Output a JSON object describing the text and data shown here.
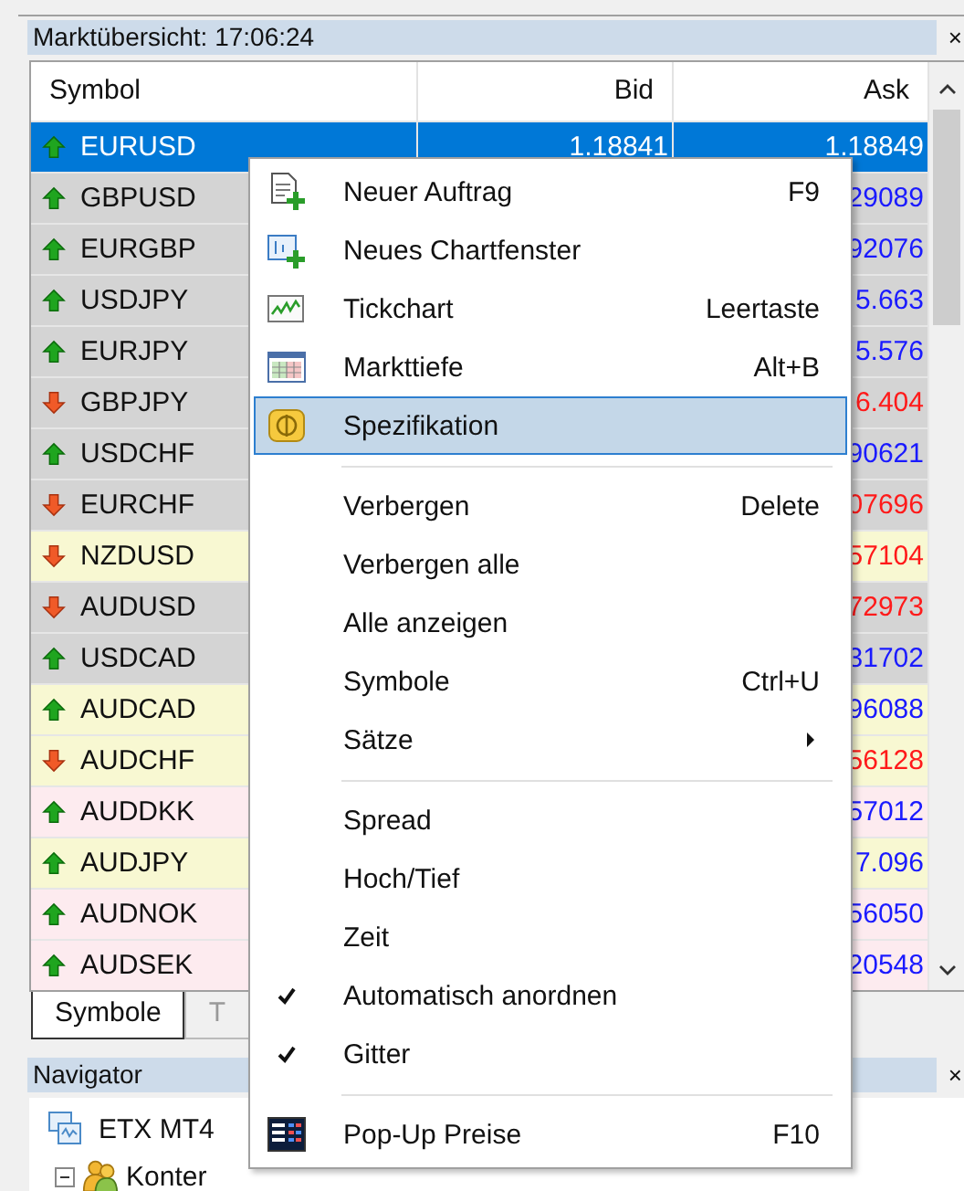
{
  "market_watch": {
    "title": "Marktübersicht: 17:06:24",
    "close": "×",
    "columns": [
      "Symbol",
      "Bid",
      "Ask"
    ],
    "rows": [
      {
        "symbol": "EURUSD",
        "bid": "1.18841",
        "ask": "1.18849",
        "kind": "up",
        "color": "#0078d7",
        "selected": true
      },
      {
        "symbol": "GBPUSD",
        "ask": "29089",
        "kind": "up",
        "color": "#d4d4d4",
        "selected": false
      },
      {
        "symbol": "EURGBP",
        "ask": "92076",
        "kind": "up",
        "color": "#d4d4d4",
        "selected": false
      },
      {
        "symbol": "USDJPY",
        "ask": "5.663",
        "kind": "up",
        "color": "#d4d4d4",
        "selected": false
      },
      {
        "symbol": "EURJPY",
        "ask": "5.576",
        "kind": "up",
        "color": "#d4d4d4",
        "selected": false
      },
      {
        "symbol": "GBPJPY",
        "ask": "6.404",
        "kind": "down",
        "color": "#d4d4d4",
        "selected": false
      },
      {
        "symbol": "USDCHF",
        "ask": "90621",
        "kind": "up",
        "color": "#d4d4d4",
        "selected": false
      },
      {
        "symbol": "EURCHF",
        "ask": "07696",
        "kind": "down",
        "color": "#d4d4d4",
        "selected": false
      },
      {
        "symbol": "NZDUSD",
        "ask": "57104",
        "kind": "down",
        "color": "#f8f8d2",
        "selected": false
      },
      {
        "symbol": "AUDUSD",
        "ask": "72973",
        "kind": "down",
        "color": "#d4d4d4",
        "selected": false
      },
      {
        "symbol": "USDCAD",
        "ask": "31702",
        "kind": "up",
        "color": "#d4d4d4",
        "selected": false
      },
      {
        "symbol": "AUDCAD",
        "ask": "96088",
        "kind": "up",
        "color": "#f8f8d2",
        "selected": false
      },
      {
        "symbol": "AUDCHF",
        "ask": "56128",
        "kind": "down",
        "color": "#f8f8d2",
        "selected": false
      },
      {
        "symbol": "AUDDKK",
        "ask": "57012",
        "kind": "up",
        "color": "#fdebef",
        "selected": false
      },
      {
        "symbol": "AUDJPY",
        "ask": "7.096",
        "kind": "up",
        "color": "#f8f8d2",
        "selected": false
      },
      {
        "symbol": "AUDNOK",
        "ask": "56050",
        "kind": "up",
        "color": "#fdebef",
        "selected": false
      },
      {
        "symbol": "AUDSEK",
        "ask": "20548",
        "kind": "up",
        "color": "#fdebef",
        "selected": false
      }
    ],
    "tabs": [
      {
        "label": "Symbole",
        "selected": true
      },
      {
        "label": "T",
        "selected": false
      }
    ]
  },
  "navigator": {
    "title": "Navigator",
    "close": "×",
    "tree": [
      {
        "label": "ETX MT4",
        "children": [
          {
            "label": "Konter",
            "expanded": true
          }
        ]
      }
    ]
  },
  "context_menu": [
    {
      "kind": "item",
      "label": "Neuer Auftrag",
      "shortcut": "F9",
      "selected": false,
      "checked": false,
      "submenu": false
    },
    {
      "kind": "item",
      "label": "Neues Chartfenster",
      "selected": false,
      "checked": false,
      "submenu": false
    },
    {
      "kind": "item",
      "label": "Tickchart",
      "shortcut": "Leertaste",
      "selected": false,
      "checked": false,
      "submenu": false
    },
    {
      "kind": "item",
      "label": "Markttiefe",
      "shortcut": "Alt+B",
      "selected": false,
      "checked": false,
      "submenu": false
    },
    {
      "kind": "item",
      "label": "Spezifikation",
      "selected": true,
      "checked": false,
      "submenu": false
    },
    {
      "kind": "separator"
    },
    {
      "kind": "item",
      "label": "Verbergen",
      "shortcut": "Delete",
      "selected": false,
      "checked": false,
      "submenu": false
    },
    {
      "kind": "item",
      "label": "Verbergen alle",
      "selected": false,
      "checked": false,
      "submenu": false
    },
    {
      "kind": "item",
      "label": "Alle anzeigen",
      "selected": false,
      "checked": false,
      "submenu": false
    },
    {
      "kind": "item",
      "label": "Symbole",
      "shortcut": "Ctrl+U",
      "selected": false,
      "checked": false,
      "submenu": false
    },
    {
      "kind": "item",
      "label": "Sätze",
      "selected": false,
      "checked": false,
      "submenu": true
    },
    {
      "kind": "separator"
    },
    {
      "kind": "item",
      "label": "Spread",
      "selected": false,
      "checked": false,
      "submenu": false
    },
    {
      "kind": "item",
      "label": "Hoch/Tief",
      "selected": false,
      "checked": false,
      "submenu": false
    },
    {
      "kind": "item",
      "label": "Zeit",
      "selected": false,
      "checked": false,
      "submenu": false
    },
    {
      "kind": "item",
      "label": "Automatisch anordnen",
      "selected": false,
      "checked": true,
      "submenu": false
    },
    {
      "kind": "item",
      "label": "Gitter",
      "selected": false,
      "checked": true,
      "submenu": false
    },
    {
      "kind": "separator"
    },
    {
      "kind": "item",
      "label": "Pop-Up Preise",
      "shortcut": "F10",
      "selected": false,
      "checked": false,
      "submenu": false
    }
  ]
}
